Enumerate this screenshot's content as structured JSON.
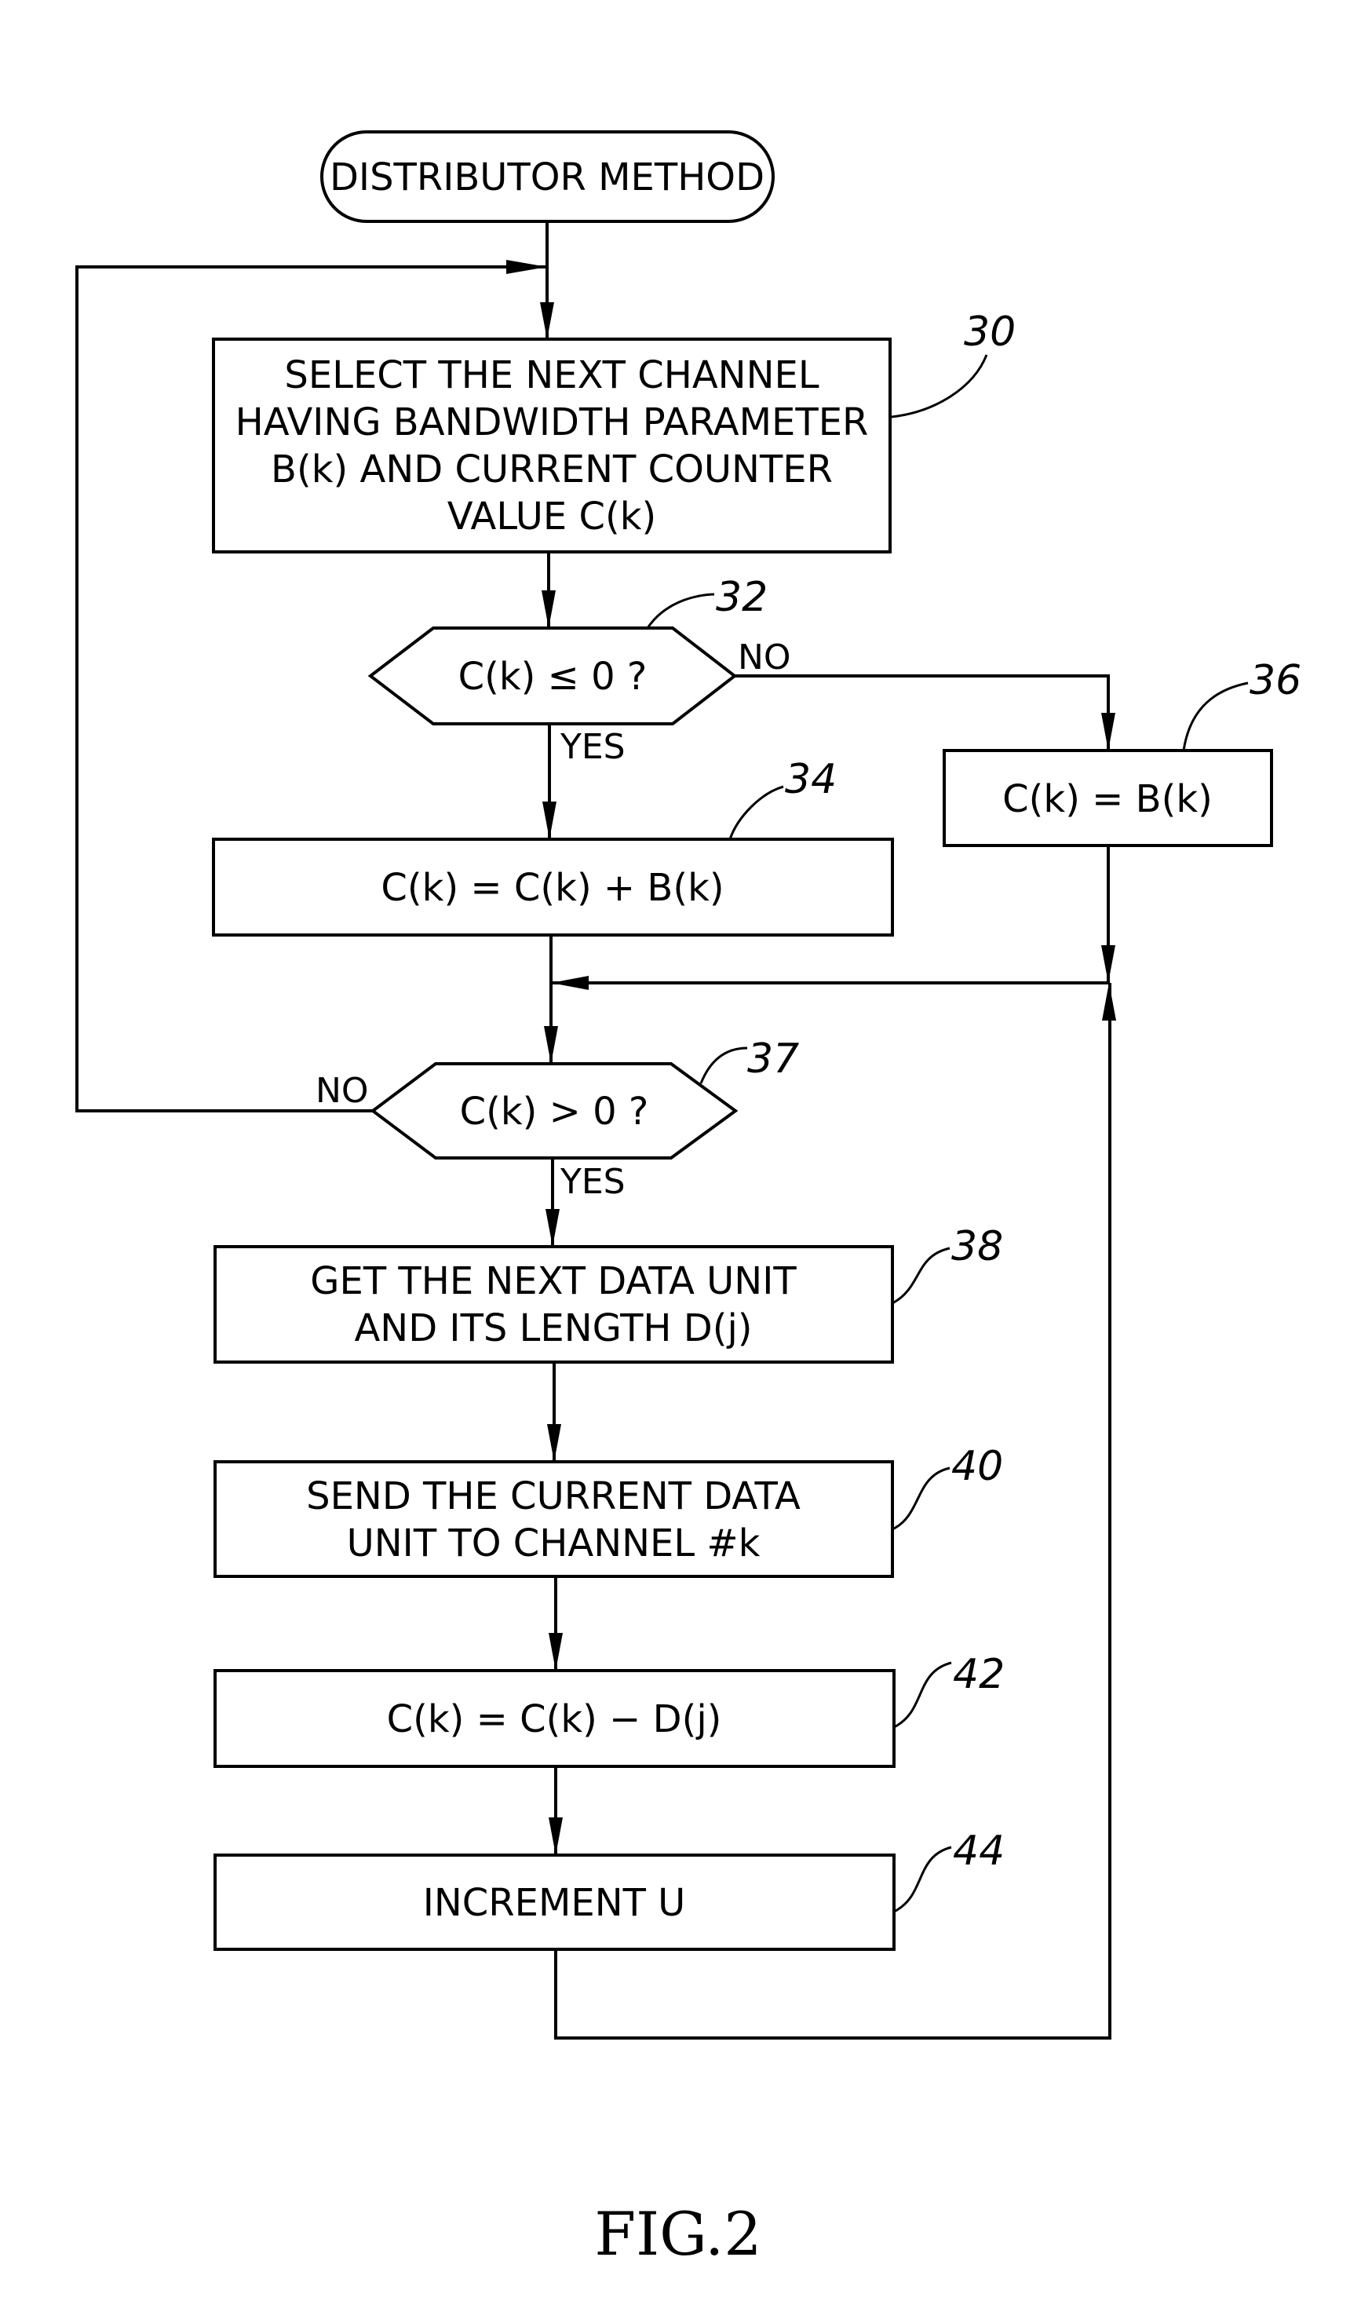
{
  "figure": {
    "caption": "FIG.2"
  },
  "nodes": {
    "start": {
      "lines": [
        "DISTRIBUTOR METHOD"
      ]
    },
    "n30": {
      "ref": "30",
      "lines": [
        "SELECT THE NEXT CHANNEL",
        "HAVING BANDWIDTH PARAMETER",
        "B(k) AND CURRENT COUNTER",
        "VALUE C(k)"
      ]
    },
    "n32": {
      "ref": "32",
      "lines": [
        "C(k) ≤ 0 ?"
      ]
    },
    "n34": {
      "ref": "34",
      "lines": [
        "C(k) = C(k) + B(k)"
      ]
    },
    "n36": {
      "ref": "36",
      "lines": [
        "C(k) = B(k)"
      ]
    },
    "n37": {
      "ref": "37",
      "lines": [
        "C(k) > 0 ?"
      ]
    },
    "n38": {
      "ref": "38",
      "lines": [
        "GET THE NEXT DATA UNIT",
        "AND ITS LENGTH D(j)"
      ]
    },
    "n40": {
      "ref": "40",
      "lines": [
        "SEND THE CURRENT DATA",
        "UNIT TO CHANNEL #k"
      ]
    },
    "n42": {
      "ref": "42",
      "lines": [
        "C(k) = C(k) − D(j)"
      ]
    },
    "n44": {
      "ref": "44",
      "lines": [
        "INCREMENT U"
      ]
    }
  },
  "branches": {
    "n32_yes": "YES",
    "n32_no": "NO",
    "n37_yes": "YES",
    "n37_no": "NO"
  }
}
